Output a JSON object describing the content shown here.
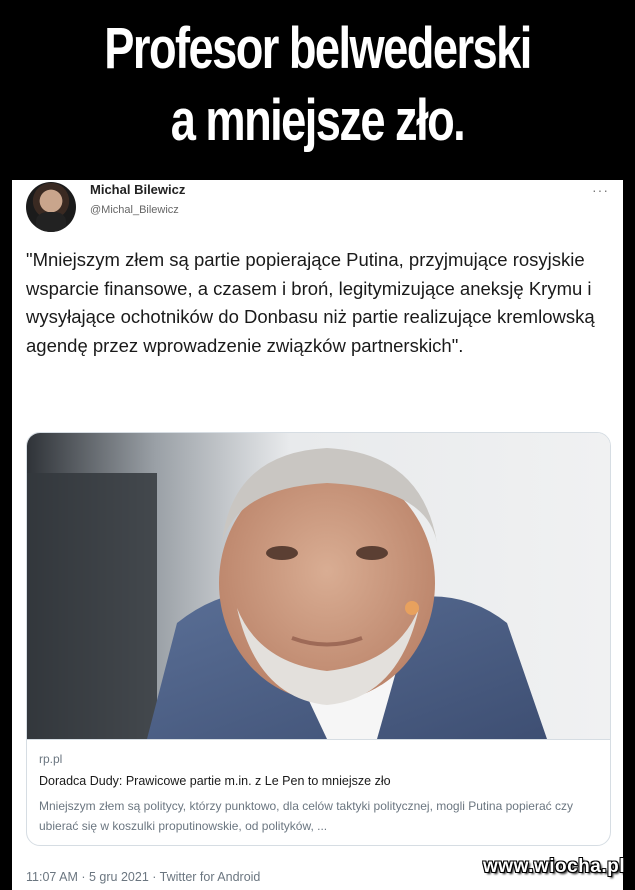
{
  "banner": {
    "line1": "Profesor belwederski",
    "line2": "a mniejsze zło."
  },
  "tweet": {
    "author_name": "Michal Bilewicz",
    "author_handle": "@Michal_Bilewicz",
    "more_icon": "more-dots-icon",
    "more_glyph": "···",
    "text": "\"Mniejszym złem są partie popierające Putina, przyjmujące rosyjskie wsparcie finansowe, a czasem i broń, legitymizujące aneksję Krymu i wysyłające ochotników do Donbasu niż partie realizujące kremlowską agendę przez wprowadzenie związków partnerskich\".",
    "card": {
      "domain": "rp.pl",
      "title": "Doradca Dudy: Prawicowe partie m.in. z Le Pen to mniejsze zło",
      "description": "Mniejszym złem są politycy, którzy punktowo, dla celów taktyki politycznej, mogli Putina popierać czy ubierać się w koszulki proputinowskie, od polityków, ..."
    },
    "footer": "11:07 AM · 5 gru 2021 · Twitter for Android"
  },
  "watermark": "www.wiocha.pl"
}
